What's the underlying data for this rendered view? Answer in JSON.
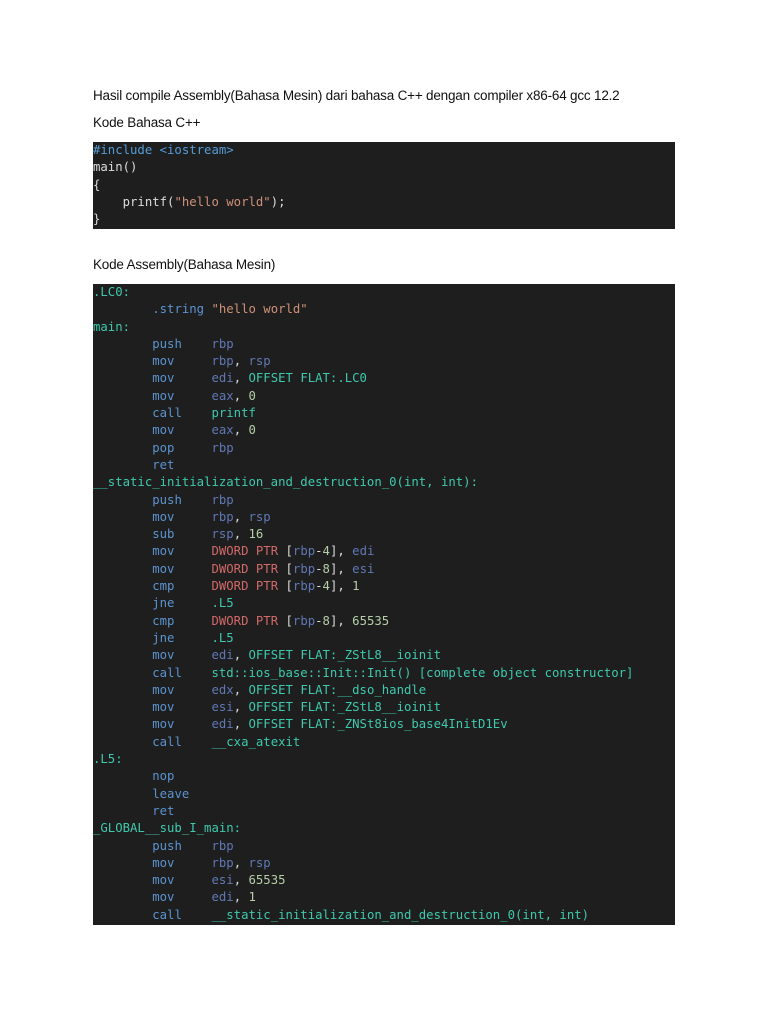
{
  "heading": "Hasil compile Assembly(Bahasa Mesin) dari bahasa C++ dengan compiler x86-64 gcc 12.2",
  "cpp_label": "Kode Bahasa C++",
  "asm_label": "Kode Assembly(Bahasa Mesin)",
  "cpp_code": [
    [
      [
        "i",
        "#include <iostream>"
      ]
    ],
    [
      [
        "p",
        "main()"
      ]
    ],
    [
      [
        "p",
        "{"
      ]
    ],
    [
      [
        "p",
        "    printf("
      ],
      [
        "s",
        "\"hello world\""
      ],
      [
        "p",
        ");"
      ]
    ],
    [
      [
        "p",
        "}"
      ]
    ]
  ],
  "asm_code": [
    [
      [
        "l",
        ".LC0:"
      ]
    ],
    [
      [
        "p",
        "        "
      ],
      [
        "k",
        ".string "
      ],
      [
        "s",
        "\"hello world\""
      ]
    ],
    [
      [
        "l",
        "main:"
      ]
    ],
    [
      [
        "p",
        "        "
      ],
      [
        "k",
        "push    "
      ],
      [
        "r",
        "rbp"
      ]
    ],
    [
      [
        "p",
        "        "
      ],
      [
        "k",
        "mov     "
      ],
      [
        "r",
        "rbp"
      ],
      [
        "p",
        ", "
      ],
      [
        "r",
        "rsp"
      ]
    ],
    [
      [
        "p",
        "        "
      ],
      [
        "k",
        "mov     "
      ],
      [
        "r",
        "edi"
      ],
      [
        "p",
        ", "
      ],
      [
        "l",
        "OFFSET FLAT:.LC0"
      ]
    ],
    [
      [
        "p",
        "        "
      ],
      [
        "k",
        "mov     "
      ],
      [
        "r",
        "eax"
      ],
      [
        "p",
        ", "
      ],
      [
        "n",
        "0"
      ]
    ],
    [
      [
        "p",
        "        "
      ],
      [
        "k",
        "call    "
      ],
      [
        "l",
        "printf"
      ]
    ],
    [
      [
        "p",
        "        "
      ],
      [
        "k",
        "mov     "
      ],
      [
        "r",
        "eax"
      ],
      [
        "p",
        ", "
      ],
      [
        "n",
        "0"
      ]
    ],
    [
      [
        "p",
        "        "
      ],
      [
        "k",
        "pop     "
      ],
      [
        "r",
        "rbp"
      ]
    ],
    [
      [
        "p",
        "        "
      ],
      [
        "k",
        "ret"
      ]
    ],
    [
      [
        "l",
        "__static_initialization_and_destruction_0(int, int):"
      ]
    ],
    [
      [
        "p",
        "        "
      ],
      [
        "k",
        "push    "
      ],
      [
        "r",
        "rbp"
      ]
    ],
    [
      [
        "p",
        "        "
      ],
      [
        "k",
        "mov     "
      ],
      [
        "r",
        "rbp"
      ],
      [
        "p",
        ", "
      ],
      [
        "r",
        "rsp"
      ]
    ],
    [
      [
        "p",
        "        "
      ],
      [
        "k",
        "sub     "
      ],
      [
        "r",
        "rsp"
      ],
      [
        "p",
        ", "
      ],
      [
        "n",
        "16"
      ]
    ],
    [
      [
        "p",
        "        "
      ],
      [
        "k",
        "mov     "
      ],
      [
        "d",
        "DWORD PTR "
      ],
      [
        "p",
        "["
      ],
      [
        "r",
        "rbp"
      ],
      [
        "p",
        "-"
      ],
      [
        "n",
        "4"
      ],
      [
        "p",
        "], "
      ],
      [
        "r",
        "edi"
      ]
    ],
    [
      [
        "p",
        "        "
      ],
      [
        "k",
        "mov     "
      ],
      [
        "d",
        "DWORD PTR "
      ],
      [
        "p",
        "["
      ],
      [
        "r",
        "rbp"
      ],
      [
        "p",
        "-"
      ],
      [
        "n",
        "8"
      ],
      [
        "p",
        "], "
      ],
      [
        "r",
        "esi"
      ]
    ],
    [
      [
        "p",
        "        "
      ],
      [
        "k",
        "cmp     "
      ],
      [
        "d",
        "DWORD PTR "
      ],
      [
        "p",
        "["
      ],
      [
        "r",
        "rbp"
      ],
      [
        "p",
        "-"
      ],
      [
        "n",
        "4"
      ],
      [
        "p",
        "], "
      ],
      [
        "n",
        "1"
      ]
    ],
    [
      [
        "p",
        "        "
      ],
      [
        "k",
        "jne     "
      ],
      [
        "l",
        ".L5"
      ]
    ],
    [
      [
        "p",
        "        "
      ],
      [
        "k",
        "cmp     "
      ],
      [
        "d",
        "DWORD PTR "
      ],
      [
        "p",
        "["
      ],
      [
        "r",
        "rbp"
      ],
      [
        "p",
        "-"
      ],
      [
        "n",
        "8"
      ],
      [
        "p",
        "], "
      ],
      [
        "n",
        "65535"
      ]
    ],
    [
      [
        "p",
        "        "
      ],
      [
        "k",
        "jne     "
      ],
      [
        "l",
        ".L5"
      ]
    ],
    [
      [
        "p",
        "        "
      ],
      [
        "k",
        "mov     "
      ],
      [
        "r",
        "edi"
      ],
      [
        "p",
        ", "
      ],
      [
        "l",
        "OFFSET FLAT:_ZStL8__ioinit"
      ]
    ],
    [
      [
        "p",
        "        "
      ],
      [
        "k",
        "call    "
      ],
      [
        "l",
        "std::ios_base::Init::Init() [complete object constructor]"
      ]
    ],
    [
      [
        "p",
        "        "
      ],
      [
        "k",
        "mov     "
      ],
      [
        "r",
        "edx"
      ],
      [
        "p",
        ", "
      ],
      [
        "l",
        "OFFSET FLAT:__dso_handle"
      ]
    ],
    [
      [
        "p",
        "        "
      ],
      [
        "k",
        "mov     "
      ],
      [
        "r",
        "esi"
      ],
      [
        "p",
        ", "
      ],
      [
        "l",
        "OFFSET FLAT:_ZStL8__ioinit"
      ]
    ],
    [
      [
        "p",
        "        "
      ],
      [
        "k",
        "mov     "
      ],
      [
        "r",
        "edi"
      ],
      [
        "p",
        ", "
      ],
      [
        "l",
        "OFFSET FLAT:_ZNSt8ios_base4InitD1Ev"
      ]
    ],
    [
      [
        "p",
        "        "
      ],
      [
        "k",
        "call    "
      ],
      [
        "l",
        "__cxa_atexit"
      ]
    ],
    [
      [
        "l",
        ".L5:"
      ]
    ],
    [
      [
        "p",
        "        "
      ],
      [
        "k",
        "nop"
      ]
    ],
    [
      [
        "p",
        "        "
      ],
      [
        "k",
        "leave"
      ]
    ],
    [
      [
        "p",
        "        "
      ],
      [
        "k",
        "ret"
      ]
    ],
    [
      [
        "l",
        "_GLOBAL__sub_I_main:"
      ]
    ],
    [
      [
        "p",
        "        "
      ],
      [
        "k",
        "push    "
      ],
      [
        "r",
        "rbp"
      ]
    ],
    [
      [
        "p",
        "        "
      ],
      [
        "k",
        "mov     "
      ],
      [
        "r",
        "rbp"
      ],
      [
        "p",
        ", "
      ],
      [
        "r",
        "rsp"
      ]
    ],
    [
      [
        "p",
        "        "
      ],
      [
        "k",
        "mov     "
      ],
      [
        "r",
        "esi"
      ],
      [
        "p",
        ", "
      ],
      [
        "n",
        "65535"
      ]
    ],
    [
      [
        "p",
        "        "
      ],
      [
        "k",
        "mov     "
      ],
      [
        "r",
        "edi"
      ],
      [
        "p",
        ", "
      ],
      [
        "n",
        "1"
      ]
    ],
    [
      [
        "p",
        "        "
      ],
      [
        "k",
        "call    "
      ],
      [
        "l",
        "__static_initialization_and_destruction_0(int, int)"
      ]
    ]
  ]
}
